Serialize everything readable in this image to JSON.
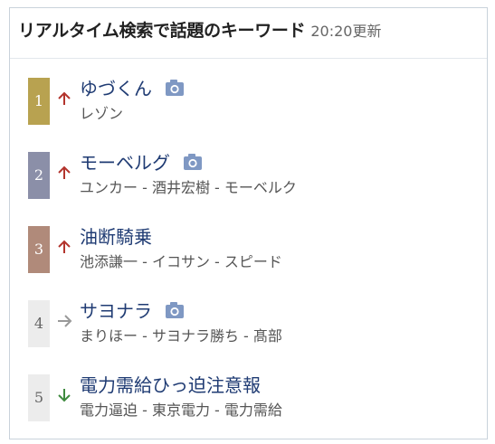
{
  "header": {
    "title": "リアルタイム検索で話題のキーワード",
    "updated": "20:20更新"
  },
  "colors": {
    "rank1": "#b8a250",
    "rank2": "#8b8fa8",
    "rank3": "#b08a7a",
    "rank_plain": "#ececec",
    "trend_up": "#b3342d",
    "trend_flat": "#999999",
    "trend_down": "#3e8a3e",
    "keyword": "#1f3b73",
    "camera_icon": "#7f98c3"
  },
  "items": [
    {
      "rank": "1",
      "trend": "up-arrow-icon",
      "keyword": "ゆづくん",
      "has_camera": true,
      "related": "レゾン"
    },
    {
      "rank": "2",
      "trend": "up-arrow-icon",
      "keyword": "モーベルグ",
      "has_camera": true,
      "related": "ユンカー - 酒井宏樹 - モーベルク"
    },
    {
      "rank": "3",
      "trend": "up-arrow-icon",
      "keyword": "油断騎乗",
      "has_camera": false,
      "related": "池添謙一 - イコサン - スピード"
    },
    {
      "rank": "4",
      "trend": "right-arrow-icon",
      "keyword": "サヨナラ",
      "has_camera": true,
      "related": "まりほー - サヨナラ勝ち - 髙部"
    },
    {
      "rank": "5",
      "trend": "down-arrow-icon",
      "keyword": "電力需給ひっ迫注意報",
      "has_camera": false,
      "related": "電力逼迫 - 東京電力 - 電力需給"
    }
  ]
}
